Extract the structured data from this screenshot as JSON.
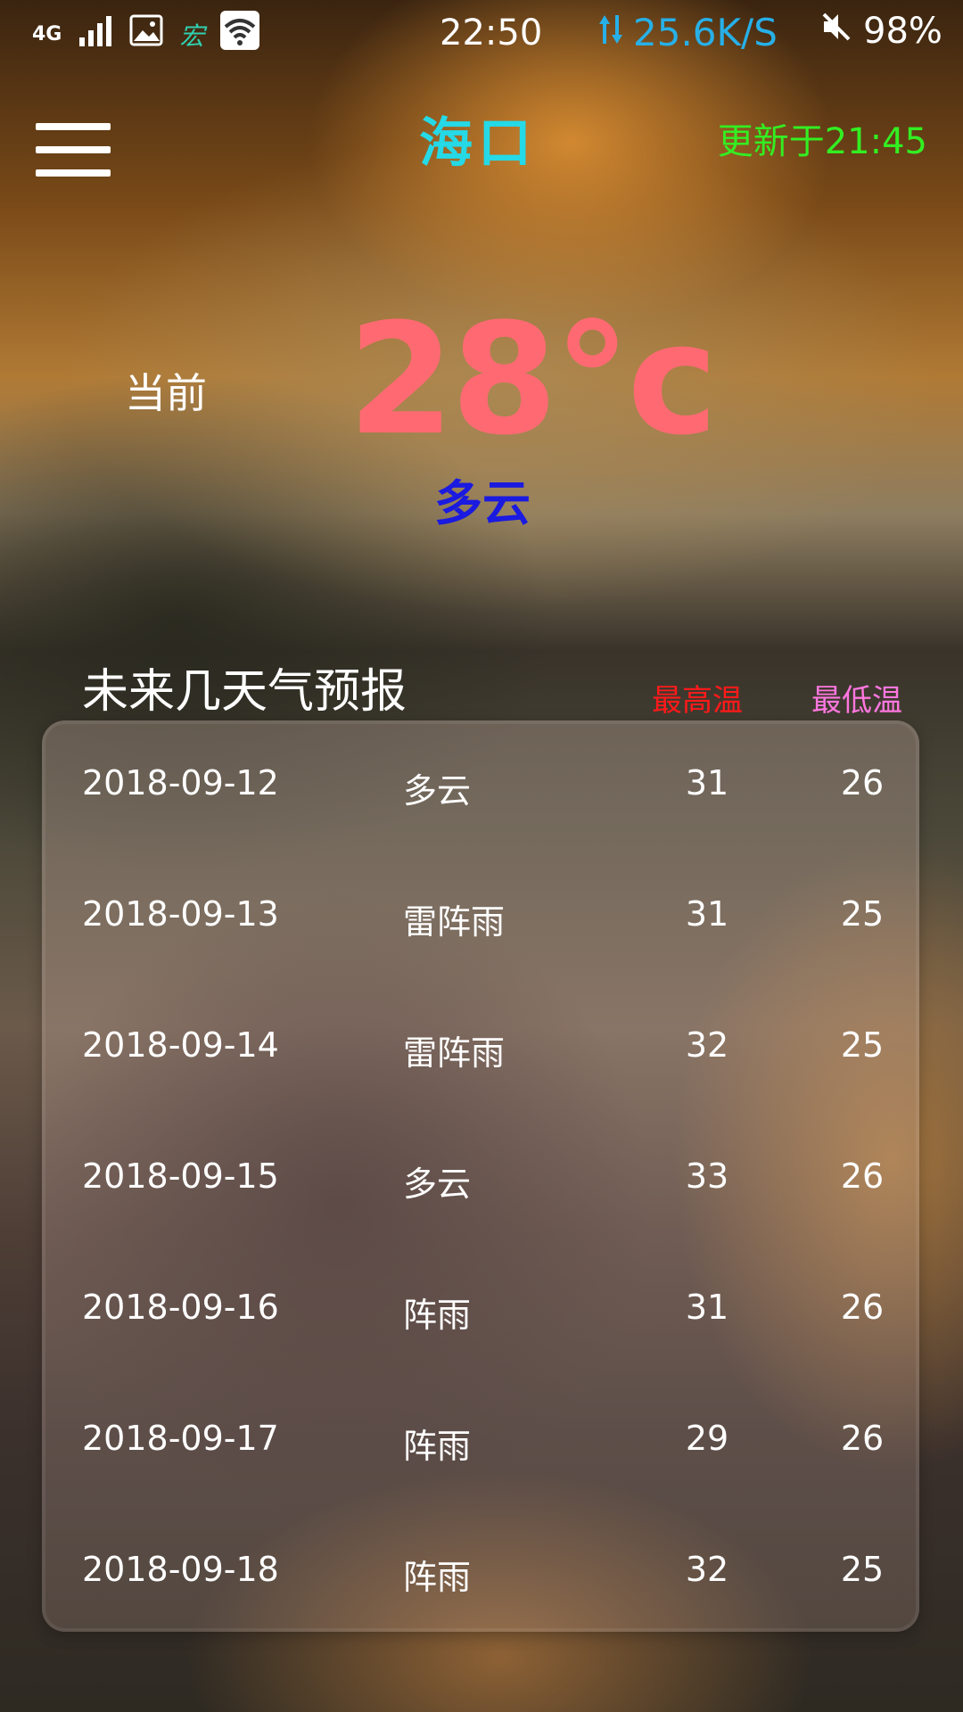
{
  "status_bar": {
    "network_type": "4G",
    "carrier_label": "宏",
    "time": "22:50",
    "net_speed": "25.6K/S",
    "battery": "98%",
    "icons": [
      "signal-icon",
      "image-icon",
      "wifi-icon",
      "data-arrows-icon",
      "mute-icon"
    ]
  },
  "header": {
    "city": "海口",
    "updated": "更新于21:45"
  },
  "current": {
    "label": "当前",
    "temperature": "28°c",
    "condition": "多云"
  },
  "forecast": {
    "title": "未来几天气预报",
    "col_high": "最高温",
    "col_low": "最低温",
    "rows": [
      {
        "date": "2018-09-12",
        "condition": "多云",
        "high": "31",
        "low": "26"
      },
      {
        "date": "2018-09-13",
        "condition": "雷阵雨",
        "high": "31",
        "low": "25"
      },
      {
        "date": "2018-09-14",
        "condition": "雷阵雨",
        "high": "32",
        "low": "25"
      },
      {
        "date": "2018-09-15",
        "condition": "多云",
        "high": "33",
        "low": "26"
      },
      {
        "date": "2018-09-16",
        "condition": "阵雨",
        "high": "31",
        "low": "26"
      },
      {
        "date": "2018-09-17",
        "condition": "阵雨",
        "high": "29",
        "low": "26"
      },
      {
        "date": "2018-09-18",
        "condition": "阵雨",
        "high": "32",
        "low": "25"
      }
    ]
  },
  "colors": {
    "city": "#25d9e6",
    "updated": "#33ee22",
    "temperature": "#ff6a72",
    "condition_now": "#1a1ae0",
    "col_high": "#ff1a1a",
    "col_low": "#ff77e0",
    "net_speed": "#27b0e8"
  }
}
